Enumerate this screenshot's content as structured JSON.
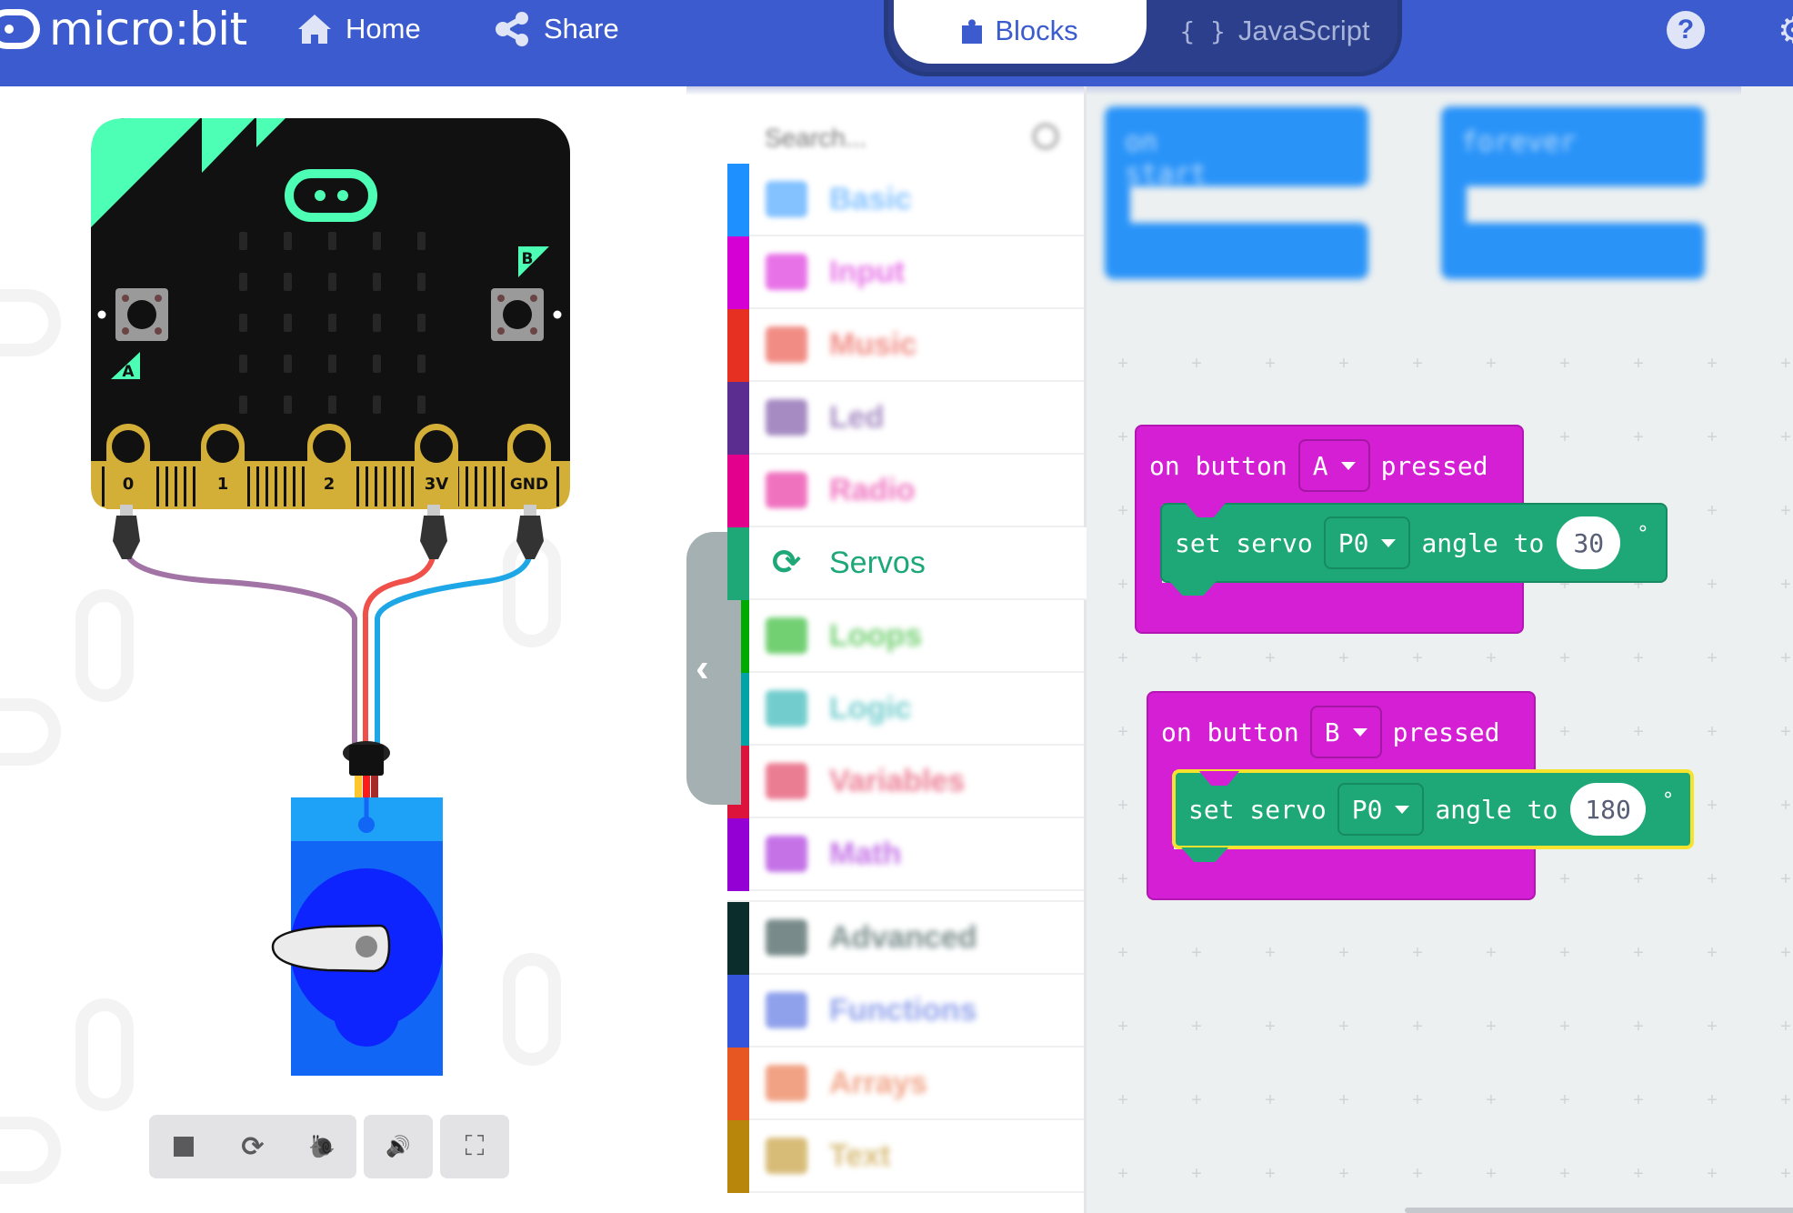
{
  "header": {
    "brand": "micro:bit",
    "nav": [
      {
        "label": "Home",
        "icon": "home-icon"
      },
      {
        "label": "Share",
        "icon": "share-icon"
      }
    ],
    "editor_toggle": {
      "blocks_label": "Blocks",
      "javascript_label": "JavaScript",
      "javascript_icon_text": "{ }",
      "active": "Blocks"
    },
    "help_glyph": "?",
    "settings_glyph": "⚙"
  },
  "simulator": {
    "board": {
      "button_labels": [
        "A",
        "B"
      ],
      "pins": [
        "0",
        "1",
        "2",
        "3V",
        "GND"
      ],
      "led_matrix": {
        "rows": 5,
        "cols": 5,
        "lit": 0
      }
    },
    "wires": [
      {
        "from_pin": "0",
        "color": "#a274a6"
      },
      {
        "from_pin": "3V",
        "color": "#f0504a"
      },
      {
        "from_pin": "GND",
        "color": "#1ea7e6"
      }
    ],
    "servo_connector_wires": [
      "#fdc62c",
      "#ff1a1a",
      "#a52a2a"
    ],
    "servo_angle_deg": 180,
    "controls": [
      {
        "name": "stop",
        "icon": "stop-icon",
        "glyph": "■"
      },
      {
        "name": "restart",
        "icon": "restart-icon",
        "glyph": "⟳"
      },
      {
        "name": "slow-mo",
        "icon": "snail-icon",
        "glyph": "🐌"
      },
      {
        "name": "mute",
        "icon": "speaker-icon",
        "glyph": "🔊"
      },
      {
        "name": "fullscreen",
        "icon": "fullscreen-icon",
        "glyph": "⛶"
      }
    ]
  },
  "toolbox": {
    "search_placeholder": "Search...",
    "collapse_glyph": "‹",
    "categories": [
      {
        "label": "Basic",
        "color": "#1e90ff"
      },
      {
        "label": "Input",
        "color": "#d400d4"
      },
      {
        "label": "Music",
        "color": "#e63022"
      },
      {
        "label": "Led",
        "color": "#5c2d91"
      },
      {
        "label": "Radio",
        "color": "#e3008c"
      },
      {
        "label": "Servos",
        "color": "#1ea878",
        "selected": true
      },
      {
        "label": "Loops",
        "color": "#00aa00"
      },
      {
        "label": "Logic",
        "color": "#00a4a6"
      },
      {
        "label": "Variables",
        "color": "#dc143c"
      },
      {
        "label": "Math",
        "color": "#9400d3"
      }
    ],
    "advanced": [
      {
        "label": "Advanced",
        "color": "#0b2d2c"
      },
      {
        "label": "Functions",
        "color": "#3455db"
      },
      {
        "label": "Arrays",
        "color": "#e65722"
      },
      {
        "label": "Text",
        "color": "#b8860b"
      }
    ]
  },
  "workspace": {
    "flyout_blocks": [
      {
        "label": "on start"
      },
      {
        "label": "forever"
      }
    ],
    "blocks": [
      {
        "event_prefix": "on button",
        "button": "A",
        "event_suffix": "pressed",
        "statement": {
          "prefix": "set servo",
          "pin": "P0",
          "middle": "angle to",
          "angle": "30",
          "unit": "°"
        },
        "selected": false
      },
      {
        "event_prefix": "on button",
        "button": "B",
        "event_suffix": "pressed",
        "statement": {
          "prefix": "set servo",
          "pin": "P0",
          "middle": "angle to",
          "angle": "180",
          "unit": "°"
        },
        "selected": true
      }
    ]
  }
}
